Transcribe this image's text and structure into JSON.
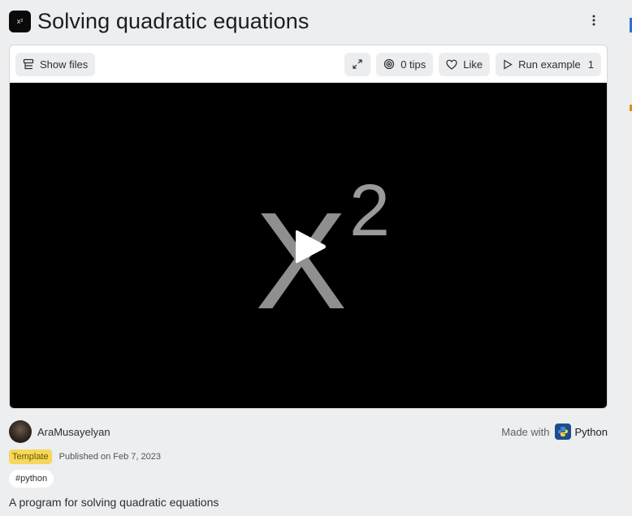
{
  "header": {
    "title": "Solving quadratic equations",
    "app_icon_text": "x²",
    "app_icon": "repl-cover-icon",
    "menu_icon": "kebab-menu-icon"
  },
  "toolbar": {
    "show_files_label": "Show files",
    "expand_icon": "expand-icon",
    "tips_label": "0 tips",
    "like_label": "Like",
    "run_example_label": "Run example",
    "run_example_count": "1"
  },
  "video": {
    "thumbnail_text": "X²",
    "play_icon": "play-icon"
  },
  "author": {
    "name": "AraMusayelyan"
  },
  "made_with": {
    "label": "Made with",
    "language": "Python",
    "language_icon": "python-logo-icon"
  },
  "meta": {
    "badge": "Template",
    "published": "Published on Feb 7, 2023"
  },
  "tags": [
    "#python"
  ],
  "description": "A program for solving quadratic equations",
  "colors": {
    "page_bg": "#eceeef",
    "badge_bg": "#f5d85a",
    "python_blue": "#1e4d8c"
  }
}
